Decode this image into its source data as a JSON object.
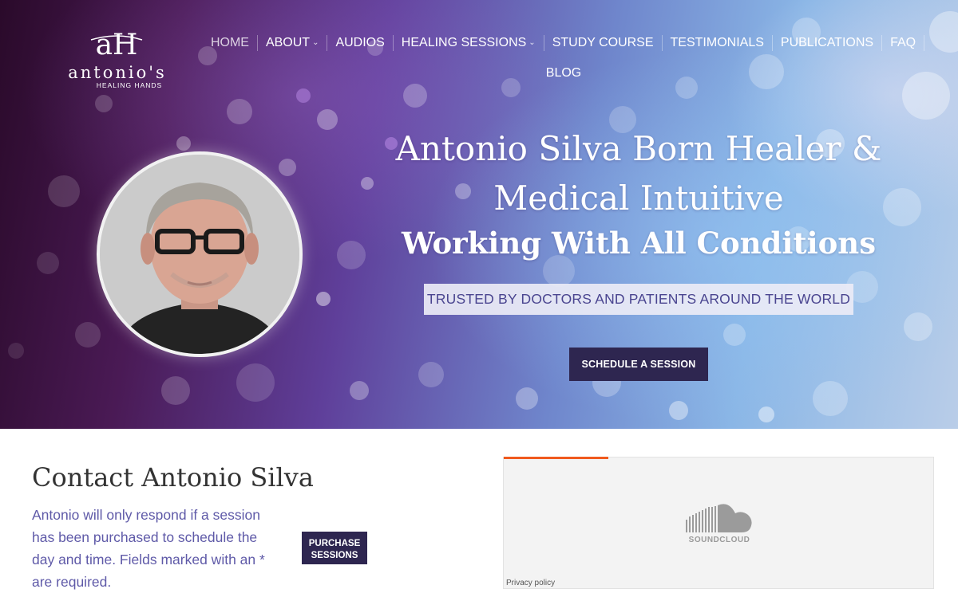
{
  "logo": {
    "mark": "aH",
    "name": "antonio's",
    "subtitle": "HEALING HANDS"
  },
  "nav": {
    "row1": [
      {
        "label": "HOME",
        "has_dropdown": false,
        "active": true
      },
      {
        "label": "ABOUT",
        "has_dropdown": true,
        "active": false
      },
      {
        "label": "AUDIOS",
        "has_dropdown": false,
        "active": false
      },
      {
        "label": "HEALING SESSIONS",
        "has_dropdown": true,
        "active": false
      },
      {
        "label": "STUDY COURSE",
        "has_dropdown": false,
        "active": false
      },
      {
        "label": "TESTIMONIALS",
        "has_dropdown": false,
        "active": false
      },
      {
        "label": "PUBLICATIONS",
        "has_dropdown": false,
        "active": false
      },
      {
        "label": "FAQ",
        "has_dropdown": false,
        "active": false
      }
    ],
    "row2": [
      {
        "label": "BLOG",
        "has_dropdown": false,
        "active": false
      }
    ],
    "dropdown_icon": "chevron-down-icon"
  },
  "hero": {
    "title_line1": "Antonio Silva Born Healer &",
    "title_line2": "Medical Intuitive",
    "subtitle": "Working With All Conditions",
    "tagline": "TRUSTED BY DOCTORS AND PATIENTS AROUND THE WORLD",
    "cta_label": "SCHEDULE A SESSION"
  },
  "contact": {
    "title": "Contact Antonio Silva",
    "text": "Antonio will only respond if a session has been purchased to schedule the day and time. Fields marked with an * are required.",
    "purchase_label_line1": "PURCHASE",
    "purchase_label_line2": "SESSIONS"
  },
  "soundcloud": {
    "label": "SOUNDCLOUD",
    "privacy": "Privacy policy",
    "accent_color": "#f05a1e"
  },
  "colors": {
    "button_bg": "#2e2650",
    "body_text": "#5f5aa8",
    "heading": "#333333"
  }
}
